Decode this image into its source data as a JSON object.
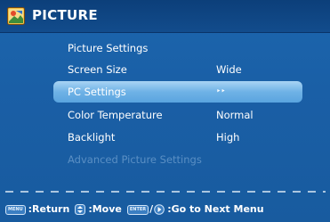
{
  "header": {
    "title": "PICTURE",
    "icon": "picture-menu-icon"
  },
  "menu": {
    "items": [
      {
        "label": "Picture Settings",
        "value": ""
      },
      {
        "label": "Screen Size",
        "value": "Wide"
      },
      {
        "label": "PC Settings",
        "value": "‣‣"
      },
      {
        "label": "Color Temperature",
        "value": "Normal"
      },
      {
        "label": "Backlight",
        "value": "High"
      },
      {
        "label": "Advanced Picture Settings",
        "value": ""
      }
    ],
    "selected_index": 2
  },
  "footer": {
    "menu_key": "MENU",
    "return_label": ":Return",
    "move_label": ":Move",
    "enter_key": "ENTER",
    "next_label": ":Go to Next Menu"
  },
  "colors": {
    "background": "#1a5fa5",
    "title_bar": "#0f4585",
    "highlight": "#7fbce9",
    "disabled_text": "#5a8fc4"
  }
}
